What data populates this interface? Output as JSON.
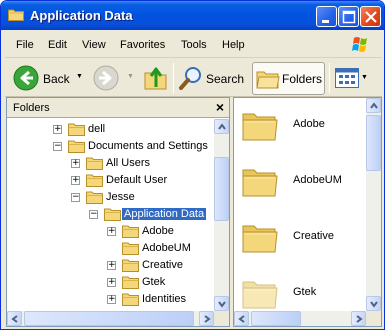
{
  "window": {
    "title": "Application Data"
  },
  "menu": {
    "items": [
      "File",
      "Edit",
      "View",
      "Favorites",
      "Tools",
      "Help"
    ]
  },
  "toolbar": {
    "back_label": "Back",
    "search_label": "Search",
    "folders_label": "Folders"
  },
  "folders_pane": {
    "title": "Folders",
    "close_glyph": "×"
  },
  "tree": {
    "items": [
      {
        "label": "dell",
        "expander": "+"
      },
      {
        "label": "Documents and Settings",
        "expander": "−"
      },
      {
        "label": "All Users",
        "expander": "+"
      },
      {
        "label": "Default User",
        "expander": "+"
      },
      {
        "label": "Jesse",
        "expander": "−"
      },
      {
        "label": "Application Data",
        "expander": "−",
        "selected": true
      },
      {
        "label": "Adobe",
        "expander": "+"
      },
      {
        "label": "AdobeUM",
        "expander": ""
      },
      {
        "label": "Creative",
        "expander": "+"
      },
      {
        "label": "Gtek",
        "expander": "+"
      },
      {
        "label": "Identities",
        "expander": "+"
      }
    ]
  },
  "content": {
    "items": [
      "Adobe",
      "AdobeUM",
      "Creative",
      "Gtek"
    ]
  },
  "colors": {
    "titlebar": "#0054e3",
    "selection": "#316ac5",
    "folder": "#f4d77a"
  }
}
